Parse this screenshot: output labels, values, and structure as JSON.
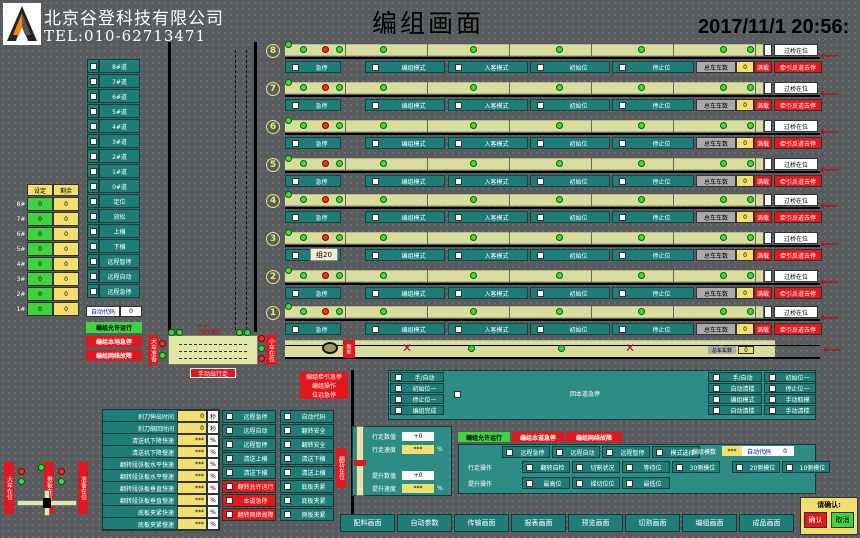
{
  "company": "北京谷登科技有限公司",
  "tel": "TEL:010-62713471",
  "page_title": "编组画面",
  "clock": "2017/11/1 20:56:",
  "left_menu": [
    "8#道",
    "7#道",
    "6#道",
    "5#道",
    "4#道",
    "3#道",
    "2#道",
    "1#道",
    "0#道",
    "定位",
    "放松",
    "上横",
    "下横",
    "远程智停",
    "远程自动",
    "远程急停"
  ],
  "left_table": {
    "headers": [
      "设定",
      "剩余"
    ],
    "rows": [
      {
        "label": "8#",
        "set": "0",
        "rem": "0"
      },
      {
        "label": "7#",
        "set": "0",
        "rem": "0"
      },
      {
        "label": "6#",
        "set": "0",
        "rem": "0"
      },
      {
        "label": "5#",
        "set": "0",
        "rem": "0"
      },
      {
        "label": "4#",
        "set": "0",
        "rem": "0"
      },
      {
        "label": "3#",
        "set": "0",
        "rem": "0"
      },
      {
        "label": "2#",
        "set": "0",
        "rem": "0"
      },
      {
        "label": "1#",
        "set": "0",
        "rem": "0"
      }
    ]
  },
  "auto_code_label": "自动代码",
  "auto_code_value": "0",
  "group_allow": "编组允许运行",
  "group_estop": "编组本地急停",
  "group_net_fault": "编组网络故障",
  "rail_labels": [
    "8",
    "7",
    "6",
    "5",
    "4",
    "3",
    "2",
    "1"
  ],
  "rail": {
    "estop": "急停",
    "mode": "编组模式",
    "enter_mode": "入客模式",
    "init": "初始位",
    "stop": "停止位",
    "car_count": "总车车数",
    "car_count_val": "0",
    "full": "满载",
    "cross_ok": "过桥在位",
    "tow_alert": "牵引反道去停"
  },
  "tooltip": "组20",
  "side_left": "大车准备",
  "side_left2": "大车运动",
  "side_right": "小车在位",
  "side_right2": "进车车位",
  "hand_exit": "手动出行走",
  "traction_group": [
    "编组牵引急停",
    "编组操作",
    "位远急停"
  ],
  "mid_panel": {
    "items": [
      "手/自动",
      "初始位一",
      "停止位一",
      "编组完成"
    ],
    "center": "回本道急停",
    "right_items": [
      "手/自动",
      "自动清楼",
      "编组模式",
      "自动清楼"
    ],
    "right_items2": [
      "初始位一",
      "停止位一",
      "手动取模",
      "手动清楼"
    ]
  },
  "params": [
    {
      "label": "刹刀伸出时间",
      "val": "0",
      "unit": "秒"
    },
    {
      "label": "刹刀缩回时间",
      "val": "0",
      "unit": "秒"
    },
    {
      "label": "清送机下降快速",
      "val": "***",
      "unit": "%"
    },
    {
      "label": "清送机下降慢速",
      "val": "***",
      "unit": "%"
    },
    {
      "label": "翻转段张板水平快速",
      "val": "***",
      "unit": "%"
    },
    {
      "label": "翻转段张板水平慢速",
      "val": "***",
      "unit": "%"
    },
    {
      "label": "翻转段张板垂直快速",
      "val": "***",
      "unit": "%"
    },
    {
      "label": "翻转段张板垂直慢速",
      "val": "***",
      "unit": "%"
    },
    {
      "label": "底板夹紧快速",
      "val": "***",
      "unit": "%"
    },
    {
      "label": "底板夹紧慢速",
      "val": "***",
      "unit": "%"
    }
  ],
  "mid_checks": [
    "远程急停",
    "远程自动",
    "远程智停",
    "清送上横",
    "清送下横",
    "翻转允许运行",
    "本道急停",
    "翻转网络故障"
  ],
  "mid_checks2": [
    "自动代码",
    "翻转安全",
    "翻转安全",
    "清送下横",
    "清送上横",
    "底板夹紧",
    "底板夹紧",
    "侧板夹紧"
  ],
  "speed": {
    "walk_count_lbl": "行走数值",
    "walk_count": "+0",
    "walk_speed_lbl": "行走速度",
    "walk_speed": "***",
    "lift_count_lbl": "提升数值",
    "lift_count": "+0",
    "lift_speed_lbl": "提升速度",
    "lift_speed": "***"
  },
  "bottom_status": [
    "编组允许运行",
    "编组本道急停",
    "编组网络故障"
  ],
  "walk_op": "行走操作",
  "lift_op": "提升操作",
  "ops": [
    "远程急停",
    "远程自动",
    "远程智停",
    "模式选择",
    "翻转自检",
    "切割状况",
    "等待位",
    "30侧模位",
    "20侧模位",
    "10侧模位",
    "最高位",
    "摇切位位",
    "最低位"
  ],
  "group_count_lbl": "编组模数",
  "group_count": "***",
  "auto_code2": "自动代码",
  "auto_code2_val": "0",
  "nav": [
    "配料画面",
    "自动参数",
    "传输画面",
    "报表画面",
    "预览画面",
    "切割画面",
    "编组画面",
    "成品画面"
  ],
  "confirm_title": "请确认:",
  "confirm_ok": "确认",
  "confirm_cancel": "取消",
  "left_vertical": [
    "大车在位",
    "推板在位",
    "准备在位"
  ],
  "colors": {
    "teal": "#1f7d78",
    "yellow": "#f2df6e",
    "green": "#3fd43f",
    "red": "#e3171c",
    "track": "#d8dc9c"
  }
}
